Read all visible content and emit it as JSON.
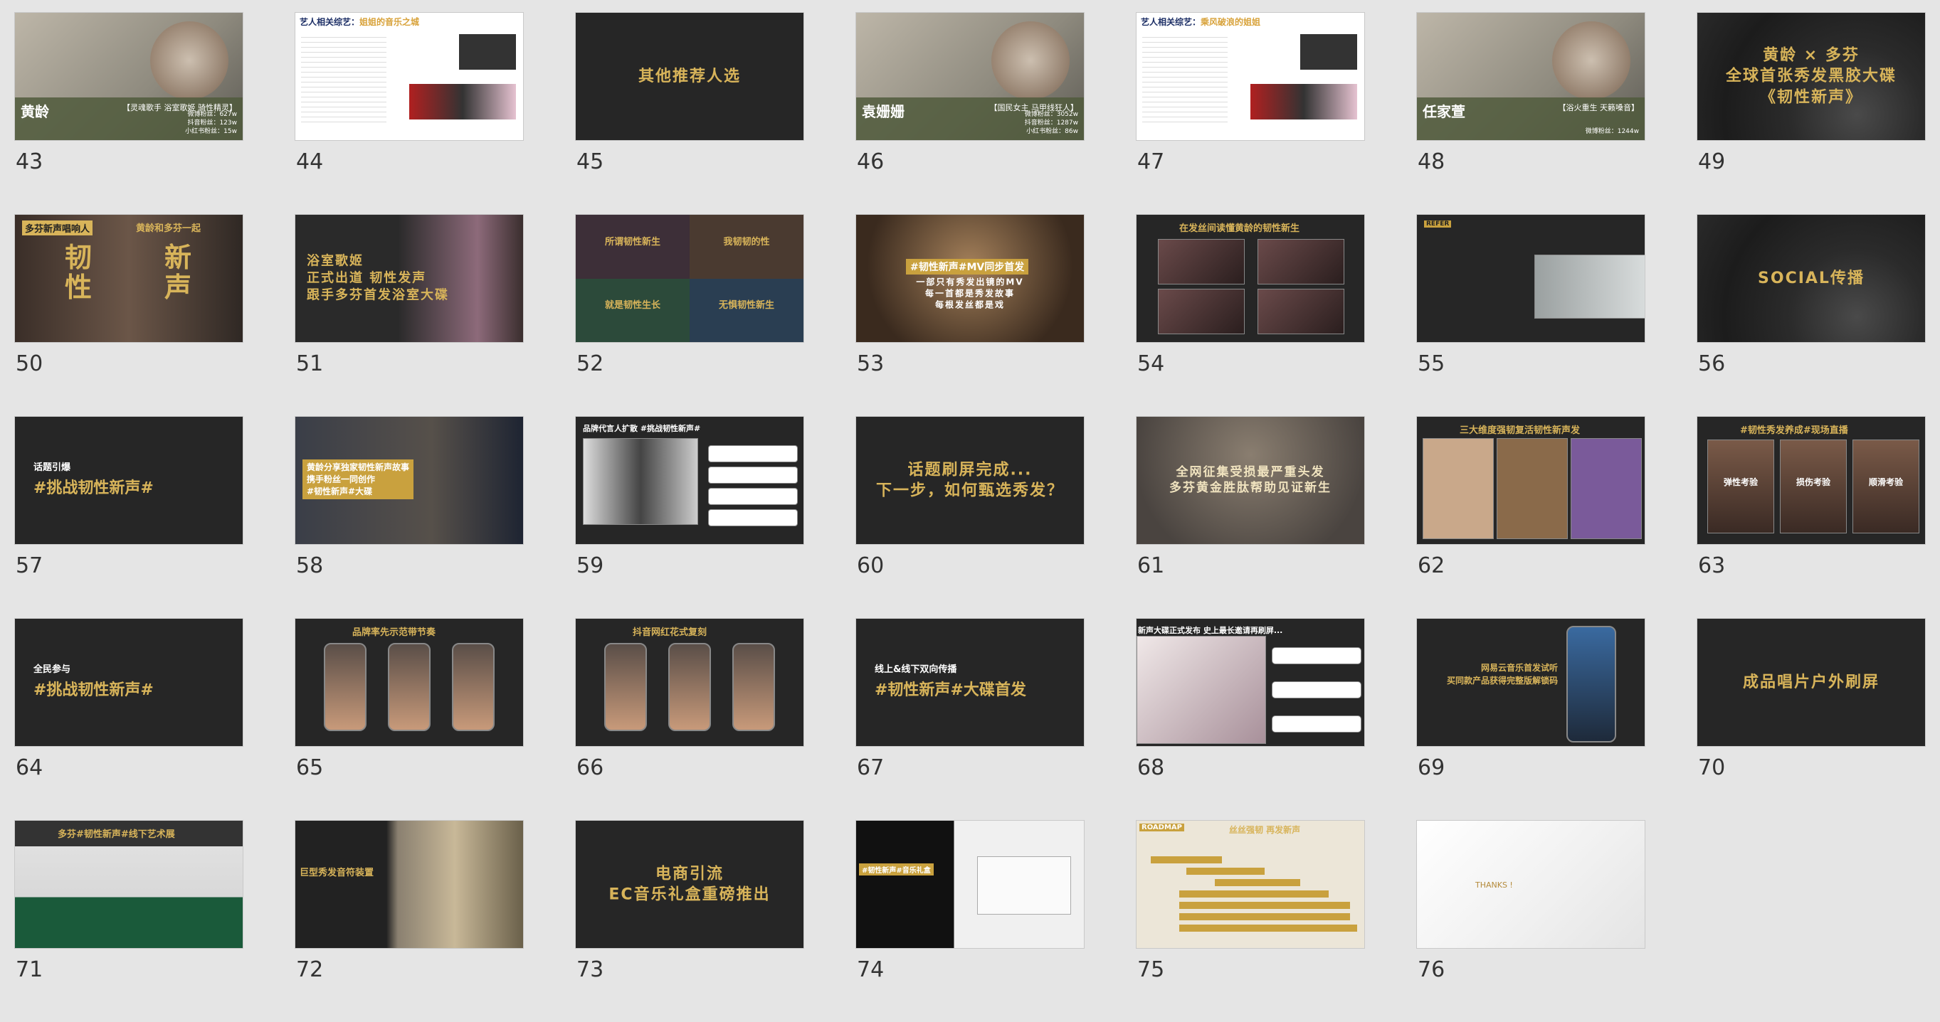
{
  "slides": [
    {
      "n": "43",
      "kind": "profile",
      "name": "黄龄",
      "tag": "【灵魂歌手 浴室歌姬 骑性精灵】",
      "stats": [
        "微博粉丝：627w",
        "抖音粉丝：123w",
        "小红书粉丝：15w"
      ]
    },
    {
      "n": "44",
      "kind": "doc",
      "title": "艺人相关综艺：",
      "title_hl": "姐姐的音乐之城"
    },
    {
      "n": "45",
      "kind": "center",
      "text": "其他推荐人选"
    },
    {
      "n": "46",
      "kind": "profile",
      "name": "袁姗姗",
      "tag": "【国民女主 马甲线狂人】",
      "stats": [
        "微博粉丝：3052w",
        "抖音粉丝：1287w",
        "小红书粉丝：86w"
      ]
    },
    {
      "n": "47",
      "kind": "doc",
      "title": "艺人相关综艺：",
      "title_hl": "乘风破浪的姐姐"
    },
    {
      "n": "48",
      "kind": "profile",
      "name": "任家萱",
      "tag": "【浴火重生 天籁嗓音】",
      "stats": [
        "微博粉丝：1244w"
      ]
    },
    {
      "n": "49",
      "kind": "center-vinyl",
      "text": "黄龄 × 多芬\n全球首张秀发黑胶大碟\n《韧性新声》"
    },
    {
      "n": "50",
      "kind": "twochar",
      "label": "多芬新声唱响人",
      "top": "黄龄和多芬一起",
      "left": "韧\n性",
      "right": "新\n声"
    },
    {
      "n": "51",
      "kind": "left-text",
      "text": "浴室歌姬\n正式出道 韧性发声\n跟手多芬首发浴室大碟"
    },
    {
      "n": "52",
      "kind": "quad",
      "q": [
        "所谓韧性新生",
        "我韧韧的性",
        "就是韧性生长",
        "无惧韧性新生"
      ]
    },
    {
      "n": "53",
      "kind": "banner",
      "hl": "#韧性新声#MV同步首发",
      "text": "一部只有秀发出镜的MV\n每一首都是秀发故事\n每根发丝都是戏"
    },
    {
      "n": "54",
      "kind": "gallery",
      "title": "在发丝间读懂黄龄的韧性新生"
    },
    {
      "n": "55",
      "kind": "ref",
      "label": "REFER",
      "caption": ""
    },
    {
      "n": "56",
      "kind": "center-vinyl",
      "text": "SOCIAL传播"
    },
    {
      "n": "57",
      "kind": "hashtag",
      "pre": "话题引爆",
      "tag": "#挑战韧性新声#"
    },
    {
      "n": "58",
      "kind": "photo-text",
      "text": "黄龄分享独家韧性新声故事\n携手粉丝一同创作\n#韧性新声#大碟"
    },
    {
      "n": "59",
      "kind": "list",
      "title": "品牌代言人扩散 #挑战韧性新声#"
    },
    {
      "n": "60",
      "kind": "center",
      "text": "话题刷屏完成...\n下一步，如何甄选秀发？"
    },
    {
      "n": "61",
      "kind": "hair",
      "text": "全网征集受损最严重头发\n多芬黄金胜肽帮助见证新生"
    },
    {
      "n": "62",
      "kind": "products",
      "title": "三大维度强韧复活韧性新声发"
    },
    {
      "n": "63",
      "kind": "three",
      "title": "#韧性秀发养成#现场直播",
      "items": [
        "弹性考验",
        "损伤考验",
        "顺滑考验"
      ]
    },
    {
      "n": "64",
      "kind": "hashtag",
      "pre": "全民参与",
      "tag": "#挑战韧性新声#"
    },
    {
      "n": "65",
      "kind": "phones",
      "title": "品牌率先示范带节奏"
    },
    {
      "n": "66",
      "kind": "phones",
      "title": "抖音网红花式复刻"
    },
    {
      "n": "67",
      "kind": "hashtag",
      "pre": "线上&线下双向传播",
      "tag": "#韧性新声#大碟首发"
    },
    {
      "n": "68",
      "kind": "chat",
      "title": "新声大碟正式发布 史上最长邀请再刷屏..."
    },
    {
      "n": "69",
      "kind": "phone-text",
      "text": "网易云音乐首发试听\n买同款产品获得完整版解锁码"
    },
    {
      "n": "70",
      "kind": "center",
      "text": "成品唱片户外刷屏"
    },
    {
      "n": "71",
      "kind": "exhibit",
      "title": "多芬#韧性新声#线下艺术展"
    },
    {
      "n": "72",
      "kind": "tunnel",
      "text": "巨型秀发音符装置"
    },
    {
      "n": "73",
      "kind": "center",
      "text": "电商引流\nEC音乐礼盒重磅推出"
    },
    {
      "n": "74",
      "kind": "giftbox",
      "hl": "#韧性新声#音乐礼盒"
    },
    {
      "n": "75",
      "kind": "roadmap",
      "label": "ROADMAP",
      "title": "丝丝强韧 再发新声"
    },
    {
      "n": "76",
      "kind": "thanks",
      "text": "THANKS !"
    }
  ]
}
